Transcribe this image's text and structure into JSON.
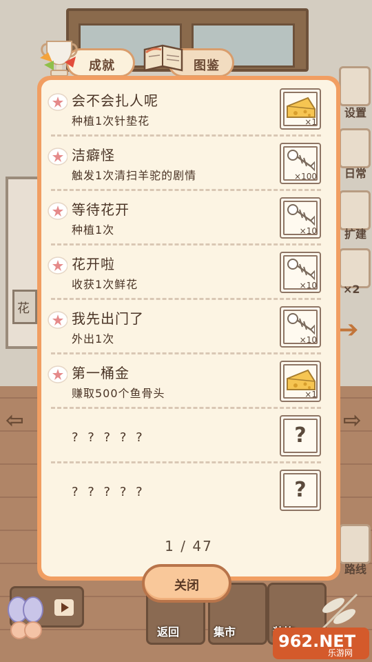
{
  "tabs": [
    {
      "label": "成就",
      "icon": "trophy-icon"
    },
    {
      "label": "图鉴",
      "icon": "book-icon"
    }
  ],
  "achievements": [
    {
      "title": "会不会扎人呢",
      "desc": "种植1次针垫花",
      "reward_icon": "cheese-icon",
      "reward_count": "×1"
    },
    {
      "title": "洁癖怪",
      "desc": "触发1次清扫羊驼的剧情",
      "reward_icon": "fishbone-icon",
      "reward_count": "×100"
    },
    {
      "title": "等待花开",
      "desc": "种植1次",
      "reward_icon": "fishbone-icon",
      "reward_count": "×10"
    },
    {
      "title": "花开啦",
      "desc": "收获1次鲜花",
      "reward_icon": "fishbone-icon",
      "reward_count": "×10"
    },
    {
      "title": "我先出门了",
      "desc": "外出1次",
      "reward_icon": "fishbone-icon",
      "reward_count": "×10"
    },
    {
      "title": "第一桶金",
      "desc": "赚取500个鱼骨头",
      "reward_icon": "cheese-icon",
      "reward_count": "×1"
    },
    {
      "title": "? ? ? ? ?",
      "reward": "?"
    },
    {
      "title": "? ? ? ? ?",
      "reward": "?"
    }
  ],
  "pager": "1 / 47",
  "close_label": "关闭",
  "background": {
    "side_labels": [
      "设置",
      "日常",
      "扩建",
      "×2",
      "路线"
    ],
    "shelf_label": "花",
    "bottom_labels": [
      "返回",
      "集市",
      "装饰"
    ],
    "watermark": "962.NET",
    "watermark_sub": "乐游网"
  },
  "colors": {
    "panel_border": "#f19e62",
    "panel_fill": "#fcf4e3",
    "text": "#4a3426",
    "accent_arrow": "#c2753a"
  }
}
